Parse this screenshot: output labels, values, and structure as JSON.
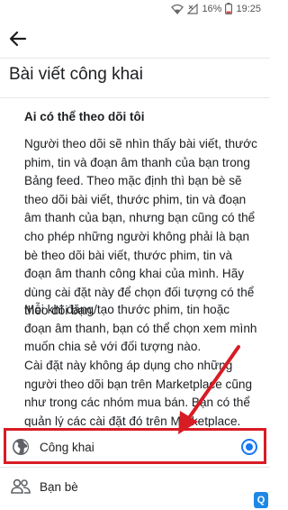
{
  "status_bar": {
    "battery_percent": "16%",
    "time": "19:25"
  },
  "app_bar": {
    "back_icon": "arrow-left-icon"
  },
  "page": {
    "title": "Bài viết công khai",
    "section_heading": "Ai có thể theo dõi tôi",
    "paragraphs": [
      "Người theo dõi sẽ nhìn thấy bài viết, thước phim, tin và đoạn âm thanh của bạn trong Bảng feed. Theo mặc định thì bạn bè sẽ theo dõi bài viết, thước phim, tin và đoạn âm thanh của bạn, nhưng bạn cũng có thể cho phép những người không phải là bạn bè theo dõi bài viết, thước phim, tin và đoạn âm thanh công khai của mình. Hãy dùng cài đặt này để chọn đối tượng có thể theo dõi bạn.",
      "Mỗi khi đăng/tạo thước phim, tin hoặc đoạn âm thanh, bạn có thể chọn xem mình muốn chia sẻ với đối tượng nào.",
      "Cài đặt này không áp dụng cho những người theo dõi bạn trên Marketplace cũng như trong các nhóm mua bán. Bạn có thể quản lý các cài đặt đó trên Marketplace."
    ]
  },
  "options": [
    {
      "label": "Công khai",
      "icon": "globe-icon",
      "selected": true
    },
    {
      "label": "Bạn bè",
      "icon": "friends-icon",
      "selected": false
    }
  ],
  "colors": {
    "accent": "#1877f2",
    "annotation": "#d81c24"
  },
  "watermark": {
    "text": "Q"
  }
}
